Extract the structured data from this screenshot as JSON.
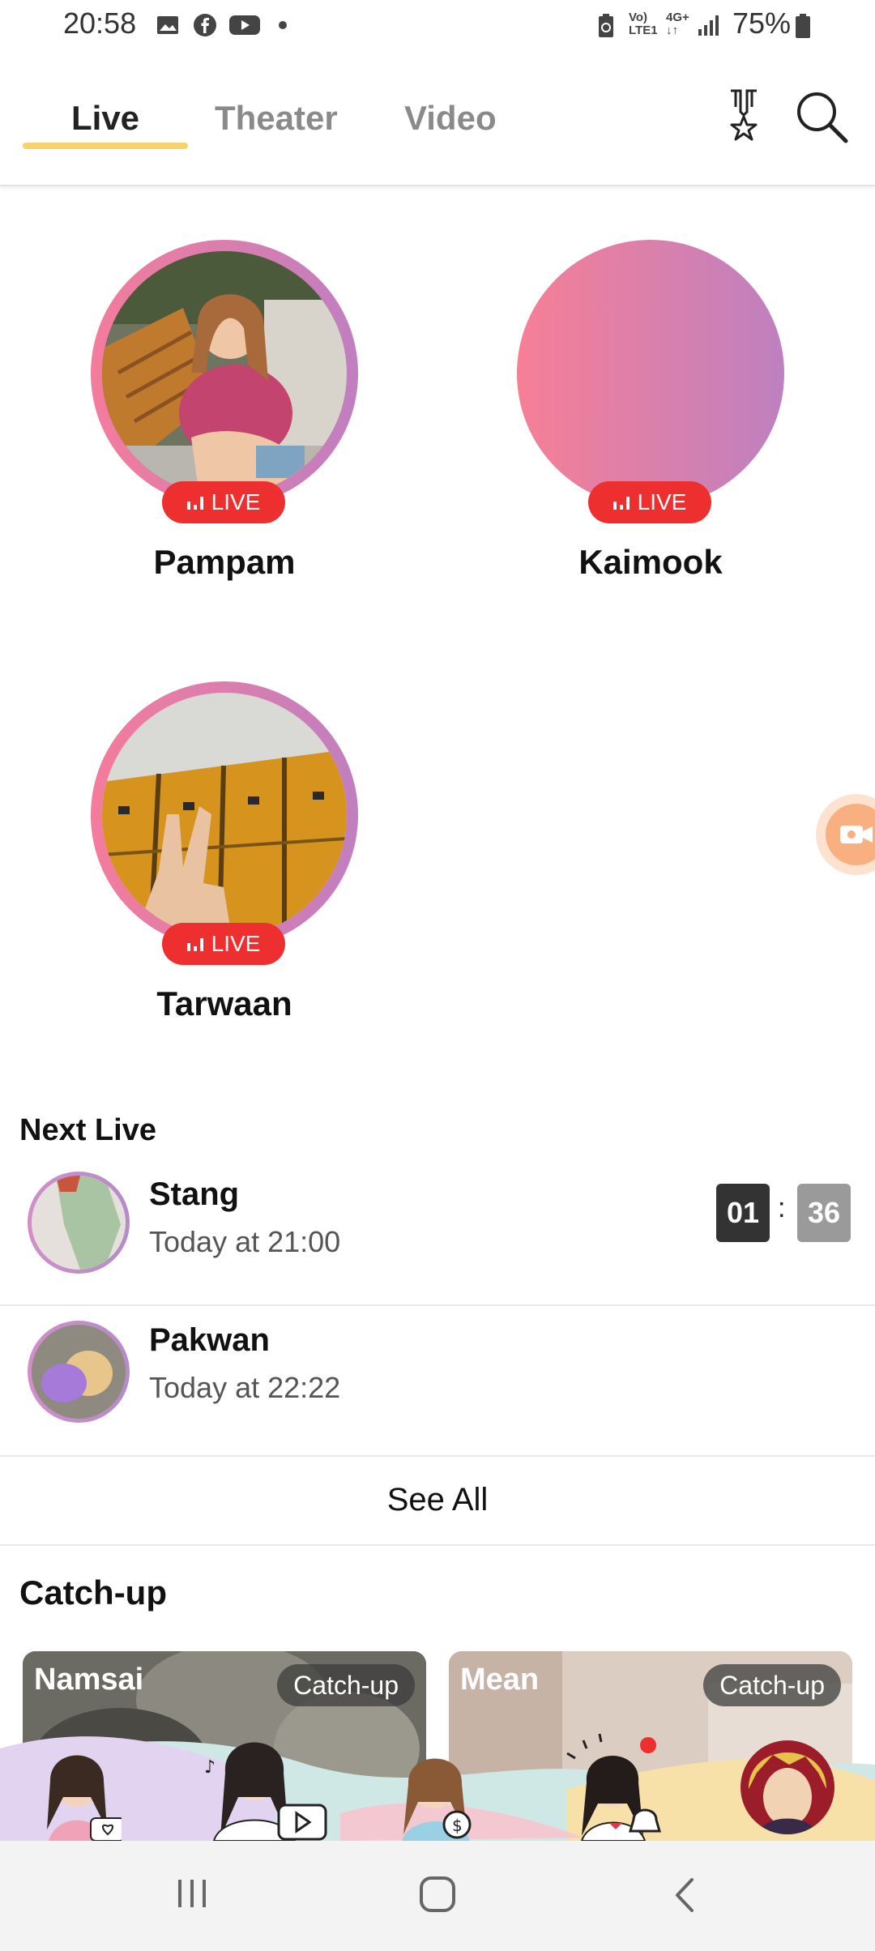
{
  "status_bar": {
    "time": "20:58",
    "battery": "75%",
    "icons": [
      "gallery-icon",
      "facebook-icon",
      "youtube-icon",
      "dot-icon",
      "battery-saver-icon",
      "volte-icon",
      "4g-icon",
      "signal-icon",
      "battery-icon"
    ]
  },
  "tabs": [
    {
      "label": "Live",
      "active": true
    },
    {
      "label": "Theater",
      "active": false
    },
    {
      "label": "Video",
      "active": false
    }
  ],
  "header_icons": [
    "ranking-medal-icon",
    "search-icon"
  ],
  "live_badge": "LIVE",
  "live_streams": [
    {
      "name": "Pampam"
    },
    {
      "name": "Kaimook"
    },
    {
      "name": "Tarwaan"
    }
  ],
  "next_live": {
    "title": "Next Live",
    "items": [
      {
        "name": "Stang",
        "time": "Today at 21:00",
        "countdown": [
          "01",
          "36"
        ]
      },
      {
        "name": "Pakwan",
        "time": "Today at 22:22"
      }
    ],
    "see_all": "See All"
  },
  "catch_up": {
    "title": "Catch-up",
    "cards": [
      {
        "name": "Namsai",
        "tag": "Catch-up"
      },
      {
        "name": "Mean",
        "tag": "Catch-up"
      }
    ]
  },
  "colors": {
    "accent": "#f7d36b",
    "live_red": "#ee2f2f",
    "ring_start": "#f47c9c",
    "ring_end": "#c07fc0"
  }
}
